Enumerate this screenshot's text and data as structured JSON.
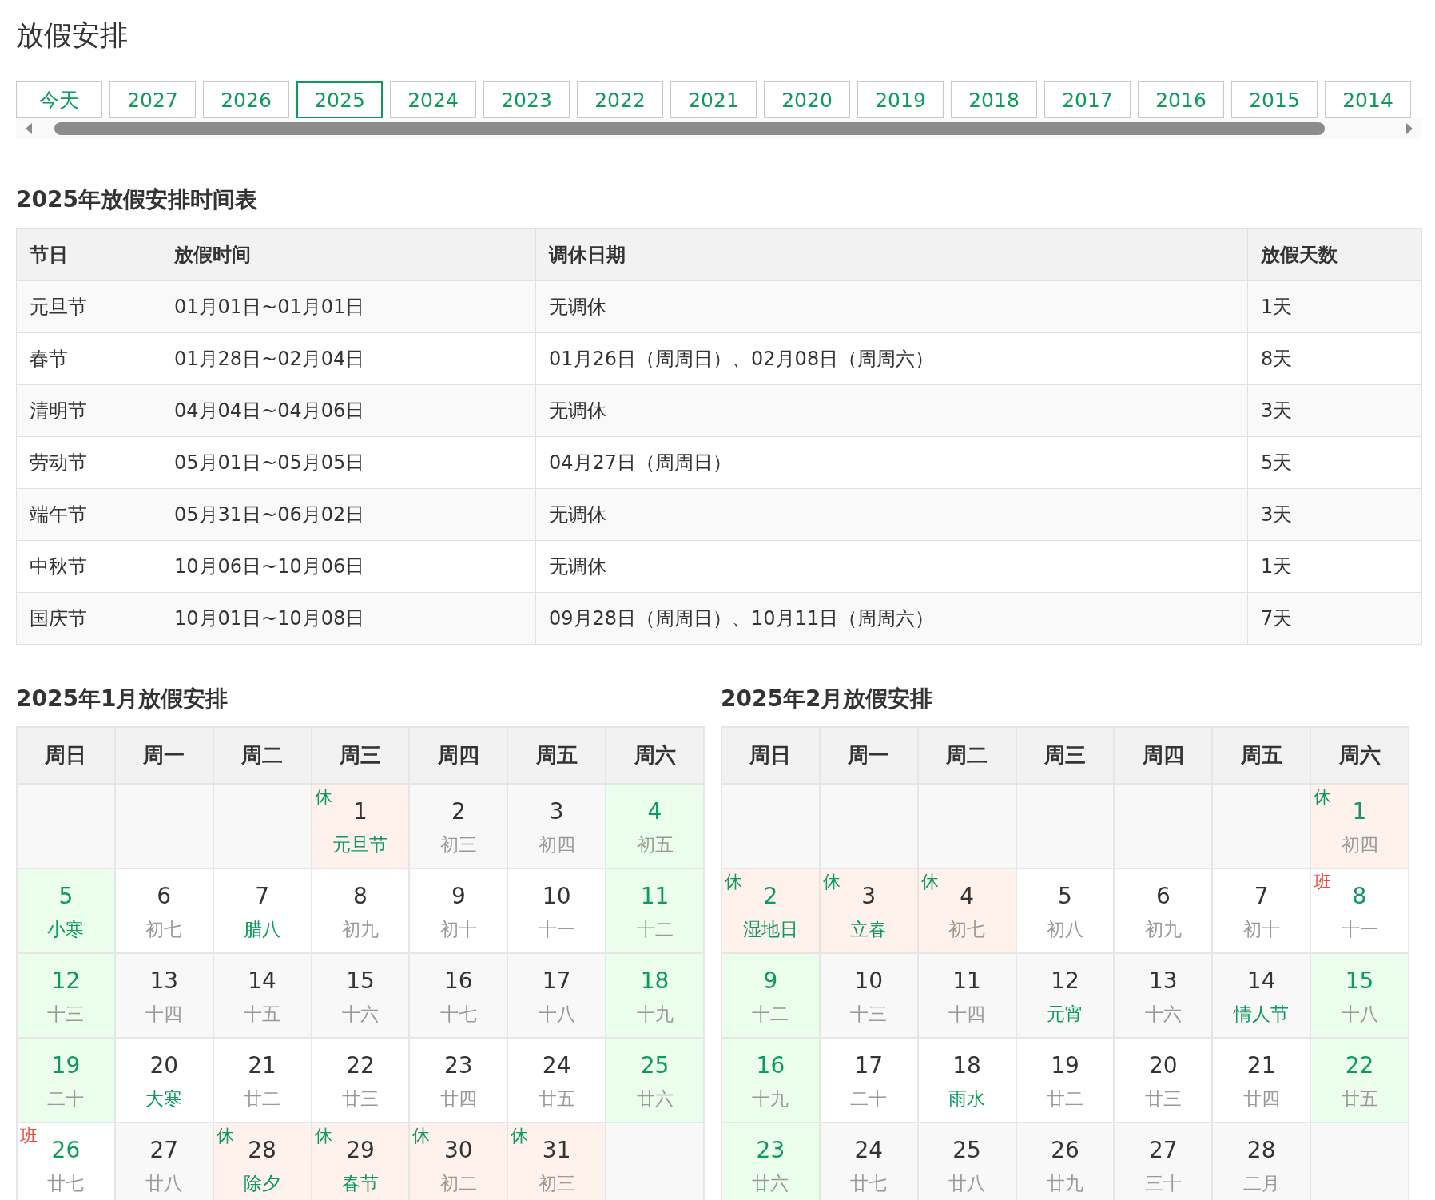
{
  "page_title": "放假安排",
  "year_tabs": [
    {
      "label": "今天",
      "selected": false
    },
    {
      "label": "2027",
      "selected": false
    },
    {
      "label": "2026",
      "selected": false
    },
    {
      "label": "2025",
      "selected": true
    },
    {
      "label": "2024",
      "selected": false
    },
    {
      "label": "2023",
      "selected": false
    },
    {
      "label": "2022",
      "selected": false
    },
    {
      "label": "2021",
      "selected": false
    },
    {
      "label": "2020",
      "selected": false
    },
    {
      "label": "2019",
      "selected": false
    },
    {
      "label": "2018",
      "selected": false
    },
    {
      "label": "2017",
      "selected": false
    },
    {
      "label": "2016",
      "selected": false
    },
    {
      "label": "2015",
      "selected": false
    },
    {
      "label": "2014",
      "selected": false
    }
  ],
  "schedule": {
    "title": "2025年放假安排时间表",
    "columns": [
      "节日",
      "放假时间",
      "调休日期",
      "放假天数"
    ],
    "rows": [
      [
        "元旦节",
        "01月01日~01月01日",
        "无调休",
        "1天"
      ],
      [
        "春节",
        "01月28日~02月04日",
        "01月26日（周周日）、02月08日（周周六）",
        "8天"
      ],
      [
        "清明节",
        "04月04日~04月06日",
        "无调休",
        "3天"
      ],
      [
        "劳动节",
        "05月01日~05月05日",
        "04月27日（周周日）",
        "5天"
      ],
      [
        "端午节",
        "05月31日~06月02日",
        "无调休",
        "3天"
      ],
      [
        "中秋节",
        "10月06日~10月06日",
        "无调休",
        "1天"
      ],
      [
        "国庆节",
        "10月01日~10月08日",
        "09月28日（周周日）、10月11日（周周六）",
        "7天"
      ]
    ]
  },
  "calendars": [
    {
      "title": "2025年1月放假安排",
      "weekdays": [
        "周日",
        "周一",
        "周二",
        "周三",
        "周四",
        "周五",
        "周六"
      ],
      "weeks": [
        [
          {
            "kind": "empty"
          },
          {
            "kind": "empty"
          },
          {
            "kind": "empty"
          },
          {
            "kind": "holiday",
            "day": "1",
            "lunar": "元旦节",
            "festival": true,
            "mark": "休"
          },
          {
            "kind": "normal",
            "day": "2",
            "lunar": "初三",
            "festival": false
          },
          {
            "kind": "normal",
            "day": "3",
            "lunar": "初四",
            "festival": false
          },
          {
            "kind": "weekend",
            "day": "4",
            "lunar": "初五",
            "festival": false
          }
        ],
        [
          {
            "kind": "weekend",
            "day": "5",
            "lunar": "小寒",
            "festival": true
          },
          {
            "kind": "normal",
            "day": "6",
            "lunar": "初七",
            "festival": false
          },
          {
            "kind": "normal",
            "day": "7",
            "lunar": "腊八",
            "festival": true
          },
          {
            "kind": "normal",
            "day": "8",
            "lunar": "初九",
            "festival": false
          },
          {
            "kind": "normal",
            "day": "9",
            "lunar": "初十",
            "festival": false
          },
          {
            "kind": "normal",
            "day": "10",
            "lunar": "十一",
            "festival": false
          },
          {
            "kind": "weekend",
            "day": "11",
            "lunar": "十二",
            "festival": false
          }
        ],
        [
          {
            "kind": "weekend",
            "day": "12",
            "lunar": "十三",
            "festival": false
          },
          {
            "kind": "normal",
            "day": "13",
            "lunar": "十四",
            "festival": false
          },
          {
            "kind": "normal",
            "day": "14",
            "lunar": "十五",
            "festival": false
          },
          {
            "kind": "normal",
            "day": "15",
            "lunar": "十六",
            "festival": false
          },
          {
            "kind": "normal",
            "day": "16",
            "lunar": "十七",
            "festival": false
          },
          {
            "kind": "normal",
            "day": "17",
            "lunar": "十八",
            "festival": false
          },
          {
            "kind": "weekend",
            "day": "18",
            "lunar": "十九",
            "festival": false
          }
        ],
        [
          {
            "kind": "weekend",
            "day": "19",
            "lunar": "二十",
            "festival": false
          },
          {
            "kind": "normal",
            "day": "20",
            "lunar": "大寒",
            "festival": true
          },
          {
            "kind": "normal",
            "day": "21",
            "lunar": "廿二",
            "festival": false
          },
          {
            "kind": "normal",
            "day": "22",
            "lunar": "廿三",
            "festival": false
          },
          {
            "kind": "normal",
            "day": "23",
            "lunar": "廿四",
            "festival": false
          },
          {
            "kind": "normal",
            "day": "24",
            "lunar": "廿五",
            "festival": false
          },
          {
            "kind": "weekend",
            "day": "25",
            "lunar": "廿六",
            "festival": false
          }
        ],
        [
          {
            "kind": "workday",
            "day": "26",
            "lunar": "廿七",
            "festival": false,
            "mark": "班"
          },
          {
            "kind": "normal",
            "day": "27",
            "lunar": "廿八",
            "festival": false
          },
          {
            "kind": "holiday",
            "day": "28",
            "lunar": "除夕",
            "festival": true,
            "mark": "休"
          },
          {
            "kind": "holiday",
            "day": "29",
            "lunar": "春节",
            "festival": true,
            "mark": "休"
          },
          {
            "kind": "holiday",
            "day": "30",
            "lunar": "初二",
            "festival": false,
            "mark": "休"
          },
          {
            "kind": "holiday",
            "day": "31",
            "lunar": "初三",
            "festival": false,
            "mark": "休"
          },
          {
            "kind": "empty"
          }
        ]
      ]
    },
    {
      "title": "2025年2月放假安排",
      "weekdays": [
        "周日",
        "周一",
        "周二",
        "周三",
        "周四",
        "周五",
        "周六"
      ],
      "weeks": [
        [
          {
            "kind": "empty"
          },
          {
            "kind": "empty"
          },
          {
            "kind": "empty"
          },
          {
            "kind": "empty"
          },
          {
            "kind": "empty"
          },
          {
            "kind": "empty"
          },
          {
            "kind": "holiday",
            "day": "1",
            "lunar": "初四",
            "festival": false,
            "mark": "休"
          }
        ],
        [
          {
            "kind": "holiday",
            "day": "2",
            "lunar": "湿地日",
            "festival": true,
            "mark": "休"
          },
          {
            "kind": "holiday",
            "day": "3",
            "lunar": "立春",
            "festival": true,
            "mark": "休"
          },
          {
            "kind": "holiday",
            "day": "4",
            "lunar": "初七",
            "festival": false,
            "mark": "休"
          },
          {
            "kind": "normal",
            "day": "5",
            "lunar": "初八",
            "festival": false
          },
          {
            "kind": "normal",
            "day": "6",
            "lunar": "初九",
            "festival": false
          },
          {
            "kind": "normal",
            "day": "7",
            "lunar": "初十",
            "festival": false
          },
          {
            "kind": "workday",
            "day": "8",
            "lunar": "十一",
            "festival": false,
            "mark": "班"
          }
        ],
        [
          {
            "kind": "weekend",
            "day": "9",
            "lunar": "十二",
            "festival": false
          },
          {
            "kind": "normal",
            "day": "10",
            "lunar": "十三",
            "festival": false
          },
          {
            "kind": "normal",
            "day": "11",
            "lunar": "十四",
            "festival": false
          },
          {
            "kind": "normal",
            "day": "12",
            "lunar": "元宵",
            "festival": true
          },
          {
            "kind": "normal",
            "day": "13",
            "lunar": "十六",
            "festival": false
          },
          {
            "kind": "normal",
            "day": "14",
            "lunar": "情人节",
            "festival": true
          },
          {
            "kind": "weekend",
            "day": "15",
            "lunar": "十八",
            "festival": false
          }
        ],
        [
          {
            "kind": "weekend",
            "day": "16",
            "lunar": "十九",
            "festival": false
          },
          {
            "kind": "normal",
            "day": "17",
            "lunar": "二十",
            "festival": false
          },
          {
            "kind": "normal",
            "day": "18",
            "lunar": "雨水",
            "festival": true
          },
          {
            "kind": "normal",
            "day": "19",
            "lunar": "廿二",
            "festival": false
          },
          {
            "kind": "normal",
            "day": "20",
            "lunar": "廿三",
            "festival": false
          },
          {
            "kind": "normal",
            "day": "21",
            "lunar": "廿四",
            "festival": false
          },
          {
            "kind": "weekend",
            "day": "22",
            "lunar": "廿五",
            "festival": false
          }
        ],
        [
          {
            "kind": "weekend",
            "day": "23",
            "lunar": "廿六",
            "festival": false
          },
          {
            "kind": "normal",
            "day": "24",
            "lunar": "廿七",
            "festival": false
          },
          {
            "kind": "normal",
            "day": "25",
            "lunar": "廿八",
            "festival": false
          },
          {
            "kind": "normal",
            "day": "26",
            "lunar": "廿九",
            "festival": false
          },
          {
            "kind": "normal",
            "day": "27",
            "lunar": "三十",
            "festival": false
          },
          {
            "kind": "normal",
            "day": "28",
            "lunar": "二月",
            "festival": false
          },
          {
            "kind": "empty"
          }
        ]
      ]
    }
  ]
}
